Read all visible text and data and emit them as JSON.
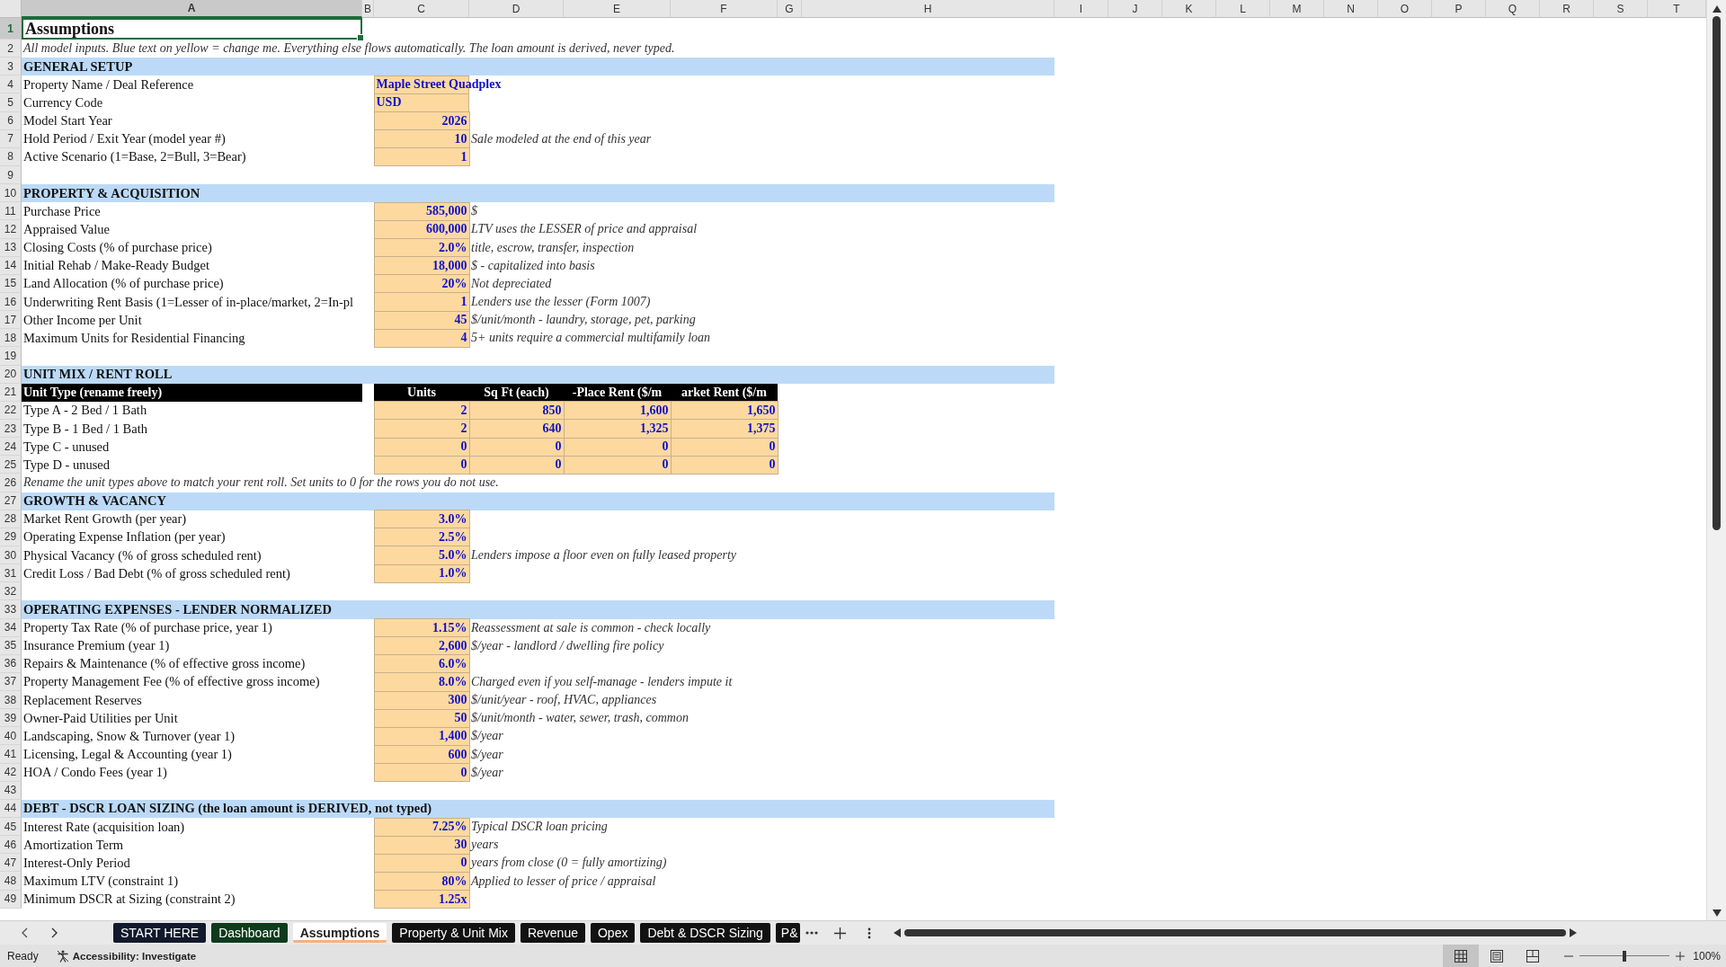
{
  "columns": [
    {
      "label": "A",
      "selected": true
    },
    {
      "label": "B",
      "selected": false
    },
    {
      "label": "C",
      "selected": false
    },
    {
      "label": "D",
      "selected": false
    },
    {
      "label": "E",
      "selected": false
    },
    {
      "label": "F",
      "selected": false
    },
    {
      "label": "G",
      "selected": false
    },
    {
      "label": "H",
      "selected": false
    },
    {
      "label": "I",
      "selected": false
    },
    {
      "label": "J",
      "selected": false
    },
    {
      "label": "K",
      "selected": false
    },
    {
      "label": "L",
      "selected": false
    },
    {
      "label": "M",
      "selected": false
    },
    {
      "label": "N",
      "selected": false
    },
    {
      "label": "O",
      "selected": false
    },
    {
      "label": "P",
      "selected": false
    },
    {
      "label": "Q",
      "selected": false
    },
    {
      "label": "R",
      "selected": false
    },
    {
      "label": "S",
      "selected": false
    },
    {
      "label": "T",
      "selected": false
    }
  ],
  "rows": [
    {
      "number": "1",
      "selected": true,
      "kind": "title",
      "label": "Assumptions"
    },
    {
      "number": "2",
      "selected": false,
      "kind": "note",
      "label": "All model inputs. Blue text on yellow = change me. Everything else flows automatically. The loan amount is derived, never typed."
    },
    {
      "number": "3",
      "selected": false,
      "kind": "section",
      "label": "GENERAL SETUP"
    },
    {
      "number": "4",
      "selected": false,
      "kind": "text_field",
      "label": "Property Name / Deal Reference",
      "value": "Maple Street Quadplex"
    },
    {
      "number": "5",
      "selected": false,
      "kind": "text_field",
      "label": "Currency Code",
      "value": "USD"
    },
    {
      "number": "6",
      "selected": false,
      "kind": "field",
      "label": "Model Start Year",
      "value": "2026"
    },
    {
      "number": "7",
      "selected": false,
      "kind": "field",
      "label": "Hold Period / Exit Year (model year #)",
      "value": "10",
      "note": "Sale modeled at the end of this year"
    },
    {
      "number": "8",
      "selected": false,
      "kind": "field",
      "label": "Active Scenario (1=Base, 2=Bull, 3=Bear)",
      "value": "1"
    },
    {
      "number": "9",
      "selected": false,
      "kind": "blank"
    },
    {
      "number": "10",
      "selected": false,
      "kind": "section",
      "label": "PROPERTY & ACQUISITION"
    },
    {
      "number": "11",
      "selected": false,
      "kind": "field",
      "label": "Purchase Price",
      "value": "585,000",
      "note": "$"
    },
    {
      "number": "12",
      "selected": false,
      "kind": "field",
      "label": "Appraised Value",
      "value": "600,000",
      "note": "LTV uses the LESSER of price and appraisal"
    },
    {
      "number": "13",
      "selected": false,
      "kind": "field",
      "label": "Closing Costs (% of purchase price)",
      "value": "2.0%",
      "note": "title, escrow, transfer, inspection"
    },
    {
      "number": "14",
      "selected": false,
      "kind": "field",
      "label": "Initial Rehab / Make-Ready Budget",
      "value": "18,000",
      "note": "$ - capitalized into basis"
    },
    {
      "number": "15",
      "selected": false,
      "kind": "field",
      "label": "Land Allocation (% of purchase price)",
      "value": "20%",
      "note": "Not depreciated"
    },
    {
      "number": "16",
      "selected": false,
      "kind": "field",
      "label": "Underwriting Rent Basis (1=Lesser of in-place/market, 2=In-pl",
      "value": "1",
      "note": "Lenders use the lesser (Form 1007)"
    },
    {
      "number": "17",
      "selected": false,
      "kind": "field",
      "label": "Other Income per Unit",
      "value": "45",
      "note": "$/unit/month - laundry, storage, pet, parking"
    },
    {
      "number": "18",
      "selected": false,
      "kind": "field",
      "label": "Maximum Units for Residential Financing",
      "value": "4",
      "note": "5+ units require a commercial multifamily loan"
    },
    {
      "number": "19",
      "selected": false,
      "kind": "blank"
    },
    {
      "number": "20",
      "selected": false,
      "kind": "section",
      "label": "UNIT MIX / RENT ROLL"
    },
    {
      "number": "21",
      "selected": false,
      "kind": "table_header",
      "label": "Unit Type (rename freely)",
      "values": [
        "Units",
        "Sq Ft (each)",
        "-Place Rent ($/m",
        "arket Rent ($/m"
      ]
    },
    {
      "number": "22",
      "selected": false,
      "kind": "table_row",
      "label": "Type A - 2 Bed / 1 Bath",
      "values": [
        "2",
        "850",
        "1,600",
        "1,650"
      ]
    },
    {
      "number": "23",
      "selected": false,
      "kind": "table_row",
      "label": "Type B - 1 Bed / 1 Bath",
      "values": [
        "2",
        "640",
        "1,325",
        "1,375"
      ]
    },
    {
      "number": "24",
      "selected": false,
      "kind": "table_row",
      "label": "Type C - unused",
      "values": [
        "0",
        "0",
        "0",
        "0"
      ]
    },
    {
      "number": "25",
      "selected": false,
      "kind": "table_row",
      "label": "Type D - unused",
      "values": [
        "0",
        "0",
        "0",
        "0"
      ]
    },
    {
      "number": "26",
      "selected": false,
      "kind": "note",
      "label": "Rename the unit types above to match your rent roll. Set units to 0 for the rows you do not use."
    },
    {
      "number": "27",
      "selected": false,
      "kind": "section",
      "label": "GROWTH & VACANCY"
    },
    {
      "number": "28",
      "selected": false,
      "kind": "field",
      "label": "Market Rent Growth (per year)",
      "value": "3.0%"
    },
    {
      "number": "29",
      "selected": false,
      "kind": "field",
      "label": "Operating Expense Inflation (per year)",
      "value": "2.5%"
    },
    {
      "number": "30",
      "selected": false,
      "kind": "field",
      "label": "Physical Vacancy (% of gross scheduled rent)",
      "value": "5.0%",
      "note": "Lenders impose a floor even on fully leased property"
    },
    {
      "number": "31",
      "selected": false,
      "kind": "field",
      "label": "Credit Loss / Bad Debt (% of gross scheduled rent)",
      "value": "1.0%"
    },
    {
      "number": "32",
      "selected": false,
      "kind": "blank"
    },
    {
      "number": "33",
      "selected": false,
      "kind": "section",
      "label": "OPERATING EXPENSES - LENDER NORMALIZED"
    },
    {
      "number": "34",
      "selected": false,
      "kind": "field",
      "label": "Property Tax Rate (% of purchase price, year 1)",
      "value": "1.15%",
      "note": "Reassessment at sale is common - check locally"
    },
    {
      "number": "35",
      "selected": false,
      "kind": "field",
      "label": "Insurance Premium (year 1)",
      "value": "2,600",
      "note": "$/year - landlord / dwelling fire policy"
    },
    {
      "number": "36",
      "selected": false,
      "kind": "field",
      "label": "Repairs & Maintenance (% of effective gross income)",
      "value": "6.0%"
    },
    {
      "number": "37",
      "selected": false,
      "kind": "field",
      "label": "Property Management Fee (% of effective gross income)",
      "value": "8.0%",
      "note": "Charged even if you self-manage - lenders impute it"
    },
    {
      "number": "38",
      "selected": false,
      "kind": "field",
      "label": "Replacement Reserves",
      "value": "300",
      "note": "$/unit/year - roof, HVAC, appliances"
    },
    {
      "number": "39",
      "selected": false,
      "kind": "field",
      "label": "Owner-Paid Utilities per Unit",
      "value": "50",
      "note": "$/unit/month - water, sewer, trash, common"
    },
    {
      "number": "40",
      "selected": false,
      "kind": "field",
      "label": "Landscaping, Snow & Turnover (year 1)",
      "value": "1,400",
      "note": "$/year"
    },
    {
      "number": "41",
      "selected": false,
      "kind": "field",
      "label": "Licensing, Legal & Accounting (year 1)",
      "value": "600",
      "note": "$/year"
    },
    {
      "number": "42",
      "selected": false,
      "kind": "field",
      "label": "HOA / Condo Fees (year 1)",
      "value": "0",
      "note": "$/year"
    },
    {
      "number": "43",
      "selected": false,
      "kind": "blank"
    },
    {
      "number": "44",
      "selected": false,
      "kind": "section",
      "label": "DEBT - DSCR LOAN SIZING (the loan amount is DERIVED, not typed)"
    },
    {
      "number": "45",
      "selected": false,
      "kind": "field",
      "label": "Interest Rate (acquisition loan)",
      "value": "7.25%",
      "note": "Typical DSCR loan pricing"
    },
    {
      "number": "46",
      "selected": false,
      "kind": "field",
      "label": "Amortization Term",
      "value": "30",
      "note": "years"
    },
    {
      "number": "47",
      "selected": false,
      "kind": "field",
      "label": "Interest-Only Period",
      "value": "0",
      "note": "years from close (0 = fully amortizing)"
    },
    {
      "number": "48",
      "selected": false,
      "kind": "field",
      "label": "Maximum LTV (constraint 1)",
      "value": "80%",
      "note": "Applied to lesser of price / appraisal"
    },
    {
      "number": "49",
      "selected": false,
      "kind": "field",
      "label": "Minimum DSCR at Sizing (constraint 2)",
      "value": "1.25x"
    }
  ],
  "sheet_tabs": [
    {
      "label": "START HERE",
      "selected": false,
      "color": "#111a2c"
    },
    {
      "label": "Dashboard",
      "selected": false,
      "color": "#0d3b1c"
    },
    {
      "label": "Assumptions",
      "selected": true,
      "color": "#f4b183"
    },
    {
      "label": "Property & Unit Mix",
      "selected": false,
      "color": "#121212"
    },
    {
      "label": "Revenue",
      "selected": false,
      "color": "#121212"
    },
    {
      "label": "Opex",
      "selected": false,
      "color": "#121212"
    },
    {
      "label": "Debt & DSCR Sizing",
      "selected": false,
      "color": "#121212"
    },
    {
      "label": "P&",
      "selected": false,
      "color": "#121212"
    }
  ],
  "status_bar": {
    "mode": "Ready",
    "accessibility": "Accessibility: Investigate",
    "views": [
      {
        "kind": "normal",
        "selected": true
      },
      {
        "kind": "page_layout",
        "selected": false
      },
      {
        "kind": "page_break",
        "selected": false
      }
    ],
    "zoom": {
      "level": 0.5,
      "reading": "100%"
    }
  }
}
